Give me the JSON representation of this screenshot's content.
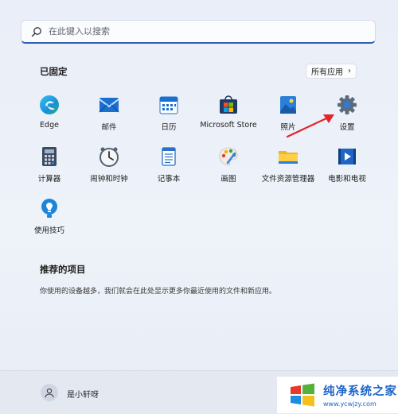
{
  "search": {
    "placeholder": "在此键入以搜索"
  },
  "pinned": {
    "title": "已固定",
    "all_apps_label": "所有应用",
    "apps": [
      {
        "label": "Edge"
      },
      {
        "label": "邮件"
      },
      {
        "label": "日历"
      },
      {
        "label": "Microsoft Store"
      },
      {
        "label": "照片"
      },
      {
        "label": "设置"
      },
      {
        "label": "计算器"
      },
      {
        "label": "闹钟和时钟"
      },
      {
        "label": "记事本"
      },
      {
        "label": "画图"
      },
      {
        "label": "文件资源管理器"
      },
      {
        "label": "电影和电视"
      },
      {
        "label": "使用技巧"
      }
    ]
  },
  "recommended": {
    "title": "推荐的项目",
    "description": "你使用的设备越多，我们就会在此处显示更多你最近使用的文件和新应用。"
  },
  "footer": {
    "user_name": "是小轩呀"
  },
  "watermark": {
    "title": "纯净系统之家",
    "url": "www.ycwjzy.com"
  },
  "colors": {
    "accent": "#2f5fae",
    "arrow": "#e0262b"
  }
}
